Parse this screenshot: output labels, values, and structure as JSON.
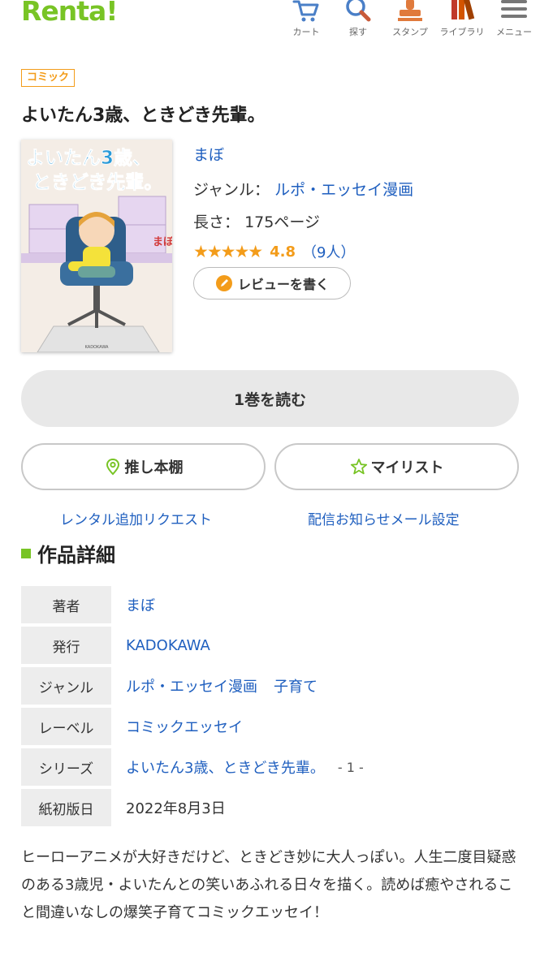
{
  "header": {
    "logo": "Renta!",
    "nav": [
      {
        "label": "カート",
        "icon": "cart-icon"
      },
      {
        "label": "探す",
        "icon": "search-icon"
      },
      {
        "label": "スタンプ",
        "icon": "stamp-icon"
      },
      {
        "label": "ライブラリ",
        "icon": "library-icon"
      },
      {
        "label": "メニュー",
        "icon": "menu-icon"
      }
    ]
  },
  "product": {
    "category": "コミック",
    "title": "よいたん3歳、ときどき先輩。",
    "cover": {
      "title_line1": "よいたん3歳、",
      "title_line2": "ときどき先輩。",
      "author_mark": "まぼ",
      "publisher_mark": "KADOKAWA"
    },
    "author": "まぼ",
    "genre_label": "ジャンル：",
    "genre": "ルポ・エッセイ漫画",
    "length_label": "長さ：",
    "length": "175ページ",
    "stars": "★★★★★",
    "rating": "4.8",
    "review_count_open": "（",
    "review_count": "9人",
    "review_count_close": "）",
    "review_button": "レビューを書く"
  },
  "actions": {
    "read": "1巻を読む",
    "oshi": "推し本棚",
    "mylist": "マイリスト",
    "rental_request": "レンタル追加リクエスト",
    "notice_setting": "配信お知らせメール設定"
  },
  "details": {
    "heading": "作品詳細",
    "rows": {
      "author": {
        "label": "著者",
        "value": "まぼ"
      },
      "publisher": {
        "label": "発行",
        "value": "KADOKAWA"
      },
      "genre": {
        "label": "ジャンル",
        "value1": "ルポ・エッセイ漫画",
        "value2": "子育て"
      },
      "label": {
        "label": "レーベル",
        "value": "コミックエッセイ"
      },
      "series": {
        "label": "シリーズ",
        "value": "よいたん3歳、ときどき先輩。",
        "volume": "- 1 -"
      },
      "release": {
        "label": "紙初版日",
        "value": "2022年8月3日"
      }
    }
  },
  "description": "ヒーローアニメが大好きだけど、ときどき妙に大人っぽい。人生二度目疑惑のある3歳児・よいたんとの笑いあふれる日々を描く。読めば癒やされること間違いなしの爆笑子育てコミックエッセイ！",
  "colors": {
    "brand": "#78c425",
    "accent": "#f39c1a",
    "link": "#1f5fbf"
  }
}
